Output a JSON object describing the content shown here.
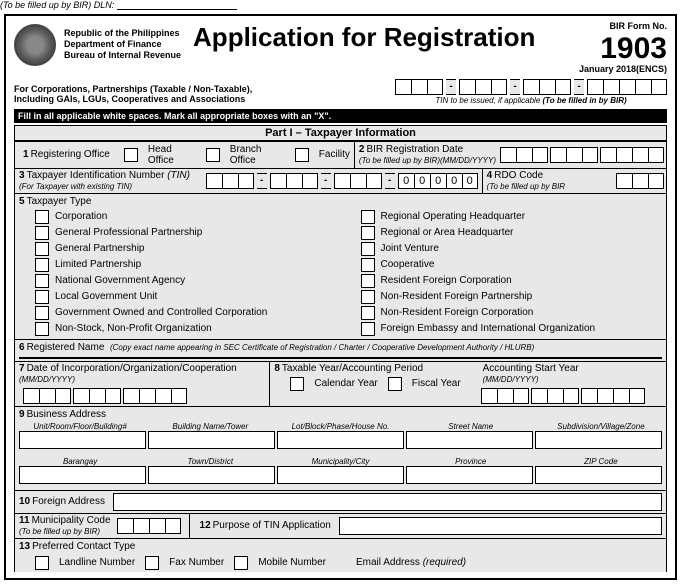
{
  "dln_label": "(To be filled up by BIR) DLN:",
  "agency": {
    "l1": "Republic of the Philippines",
    "l2": "Department of Finance",
    "l3": "Bureau of Internal Revenue"
  },
  "title": "Application for Registration",
  "form": {
    "label": "BIR Form No.",
    "number": "1903",
    "rev": "January 2018(ENCS)"
  },
  "subhead": {
    "l1": "For Corporations, Partnerships (Taxable / Non-Taxable),",
    "l2": "Including GAIs, LGUs, Cooperatives and Associations"
  },
  "tin_note_a": "TIN to be issued, if applicable ",
  "tin_note_b": "(To be filled in by BIR)",
  "blackbar": "Fill in all applicable white spaces. Mark all appropriate boxes with an \"X\".",
  "part1": "Part I – Taxpayer Information",
  "f1": {
    "num": "1",
    "label": "Registering Office",
    "o1": "Head Office",
    "o2": "Branch Office",
    "o3": "Facility"
  },
  "f2": {
    "num": "2",
    "label": "BIR Registration Date",
    "note": "(To be filled up by BIR)(MM/DD/YYYY)"
  },
  "f3": {
    "num": "3",
    "label": "Taxpayer Identification Number",
    "abbr": "(TIN)",
    "note": "(For Taxpayer with existing TIN)",
    "zeros": [
      "0",
      "0",
      "0",
      "0",
      "0"
    ]
  },
  "f4": {
    "num": "4",
    "label": "RDO Code",
    "note": "(To be filled up by BIR"
  },
  "f5": {
    "num": "5",
    "label": "Taxpayer Type",
    "left": [
      "Corporation",
      "General Professional Partnership",
      "General Partnership",
      "Limited Partnership",
      "National Government Agency",
      "Local Government Unit",
      "Government Owned and Controlled Corporation",
      "Non-Stock, Non-Profit Organization"
    ],
    "right": [
      "Regional Operating Headquarter",
      "Regional or Area Headquarter",
      "Joint Venture",
      "Cooperative",
      "Resident Foreign Corporation",
      "Non-Resident Foreign Partnership",
      "Non-Resident Foreign Corporation",
      "Foreign Embassy and International Organization"
    ]
  },
  "f6": {
    "num": "6",
    "label": "Registered Name",
    "note": "(Copy exact name appearing in SEC Certificate of Registration / Charter / Cooperative Development Authority / HLURB)"
  },
  "f7": {
    "num": "7",
    "label": "Date of Incorporation/Organization/Cooperation",
    "note": "(MM/DD/YYYY)"
  },
  "f8": {
    "num": "8",
    "label": "Taxable Year/Accounting Period",
    "o1": "Calendar Year",
    "o2": "Fiscal Year",
    "acc": "Accounting Start Year",
    "accnote": "(MM/DD/YYYY)"
  },
  "f9": {
    "num": "9",
    "label": "Business Address",
    "r1": [
      "Unit/Room/Floor/Building#",
      "Building Name/Tower",
      "Lot/Block/Phase/House No.",
      "Street  Name",
      "Subdivision/Village/Zone"
    ],
    "r2": [
      "Barangay",
      "Town/District",
      "Municipality/City",
      "Province",
      "ZIP Code"
    ]
  },
  "f10": {
    "num": "10",
    "label": "Foreign Address"
  },
  "f11": {
    "num": "11",
    "label": "Municipality Code",
    "note": "(To be filled up by BIR)"
  },
  "f12": {
    "num": "12",
    "label": "Purpose of TIN Application"
  },
  "f13": {
    "num": "13",
    "label": "Preferred Contact Type",
    "o1": "Landline Number",
    "o2": "Fax Number",
    "o3": "Mobile Number",
    "o4a": "Email Address ",
    "o4b": "(required)"
  }
}
